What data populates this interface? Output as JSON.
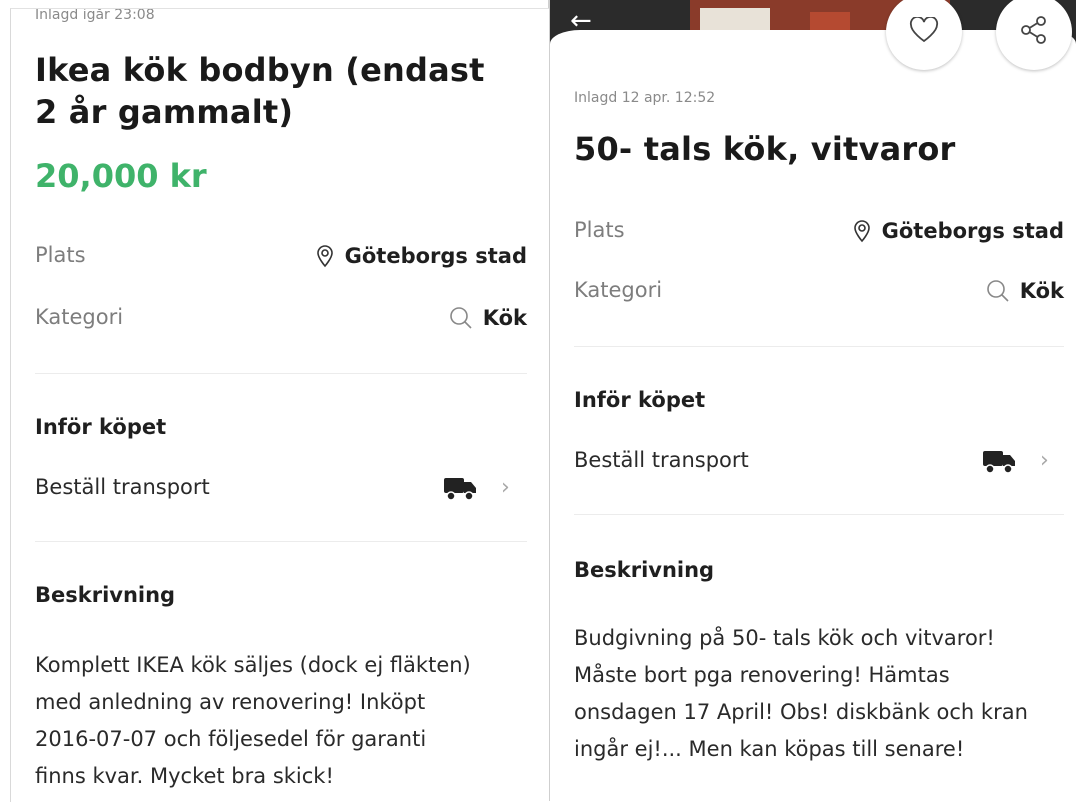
{
  "left": {
    "posted": "Inlagd igår 23:08",
    "title_line1": "Ikea kök bodbyn (endast",
    "title_line2": "2 år gammalt)",
    "price": "20,000 kr",
    "location_label": "Plats",
    "location_value": "Göteborgs stad",
    "category_label": "Kategori",
    "category_value": "Kök",
    "before_buy_title": "Inför köpet",
    "transport_label": "Beställ transport",
    "description_title": "Beskrivning",
    "description_lines": [
      "Komplett IKEA kök säljes (dock ej fläkten)",
      "med anledning av renovering! Inköpt",
      "2016-07-07 och följesedel för garanti",
      "finns kvar. Mycket bra skick!"
    ]
  },
  "right": {
    "posted": "Inlagd 12 apr. 12:52",
    "title": "50- tals kök, vitvaror",
    "location_label": "Plats",
    "location_value": "Göteborgs stad",
    "category_label": "Kategori",
    "category_value": "Kök",
    "before_buy_title": "Inför köpet",
    "transport_label": "Beställ transport",
    "description_title": "Beskrivning",
    "description_lines": [
      "Budgivning på 50- tals kök och vitvaror!",
      "Måste bort pga renovering! Hämtas",
      "onsdagen 17 April! Obs! diskbänk och kran",
      "ingår ej!... Men kan köpas till senare!"
    ]
  },
  "icons": {
    "back": "arrow-left-icon",
    "favorite": "heart-icon",
    "share": "share-icon",
    "location": "location-pin-icon",
    "category": "search-icon",
    "transport": "truck-icon",
    "chevron": "chevron-right-icon"
  },
  "colors": {
    "price": "#3fb36a",
    "muted": "#7d7d7d"
  }
}
